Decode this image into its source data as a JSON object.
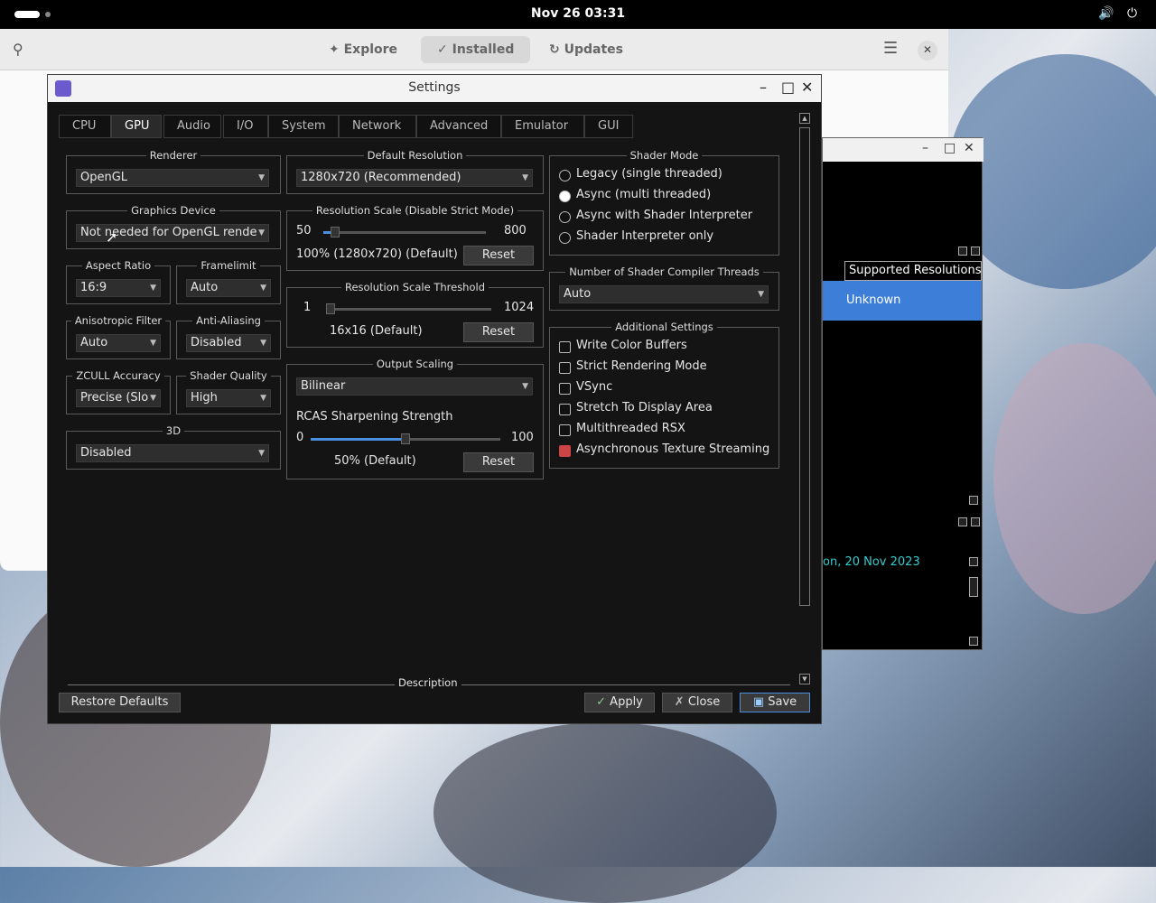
{
  "topbar": {
    "clock": "Nov 26  03:31"
  },
  "store": {
    "tabs": [
      {
        "icon": "✦",
        "label": "Explore"
      },
      {
        "icon": "✓",
        "label": "Installed"
      },
      {
        "icon": "↻",
        "label": "Updates"
      }
    ]
  },
  "gamewin": {
    "column_header": "Supported Resolutions",
    "selected_value": "Unknown",
    "date_text": "on, 20 Nov 2023"
  },
  "settings": {
    "title": "Settings",
    "tabs": [
      "CPU",
      "GPU",
      "Audio",
      "I/O",
      "System",
      "Network",
      "Advanced",
      "Emulator",
      "GUI"
    ],
    "active_tab": "GPU",
    "renderer": {
      "label": "Renderer",
      "value": "OpenGL"
    },
    "graphics_device": {
      "label": "Graphics Device",
      "value": "Not needed for OpenGL rende"
    },
    "aspect_ratio": {
      "label": "Aspect Ratio",
      "value": "16:9"
    },
    "framelimit": {
      "label": "Framelimit",
      "value": "Auto"
    },
    "anisotropic": {
      "label": "Anisotropic Filter",
      "value": "Auto"
    },
    "anti_aliasing": {
      "label": "Anti-Aliasing",
      "value": "Disabled"
    },
    "zcull": {
      "label": "ZCULL Accuracy",
      "value": "Precise (Slo"
    },
    "shader_quality": {
      "label": "Shader Quality",
      "value": "High"
    },
    "three_d": {
      "label": "3D",
      "value": "Disabled"
    },
    "default_resolution": {
      "label": "Default Resolution",
      "value": "1280x720 (Recommended)"
    },
    "resolution_scale": {
      "label": "Resolution Scale (Disable Strict Mode)",
      "min": "50",
      "max": "800",
      "value_text": "100% (1280x720) (Default)",
      "reset": "Reset",
      "fraction": 0.07
    },
    "resolution_threshold": {
      "label": "Resolution Scale Threshold",
      "min": "1",
      "max": "1024",
      "value_text": "16x16 (Default)",
      "reset": "Reset",
      "fraction": 0.02
    },
    "output_scaling": {
      "label": "Output Scaling",
      "value": "Bilinear",
      "rcas_label": "RCAS Sharpening Strength",
      "min": "0",
      "max": "100",
      "value_text": "50% (Default)",
      "reset": "Reset",
      "fraction": 0.5
    },
    "shader_mode": {
      "label": "Shader Mode",
      "options": [
        {
          "label": "Legacy (single threaded)",
          "checked": false
        },
        {
          "label": "Async (multi threaded)",
          "checked": true
        },
        {
          "label": "Async with Shader Interpreter",
          "checked": false
        },
        {
          "label": "Shader Interpreter only",
          "checked": false
        }
      ]
    },
    "shader_threads": {
      "label": "Number of Shader Compiler Threads",
      "value": "Auto"
    },
    "additional": {
      "label": "Additional Settings",
      "options": [
        {
          "label": "Write Color Buffers",
          "checked": false
        },
        {
          "label": "Strict Rendering Mode",
          "checked": false
        },
        {
          "label": "VSync",
          "checked": false
        },
        {
          "label": "Stretch To Display Area",
          "checked": false
        },
        {
          "label": "Multithreaded RSX",
          "checked": false
        },
        {
          "label": "Asynchronous Texture Streaming",
          "checked": true
        }
      ]
    },
    "description_label": "Description",
    "buttons": {
      "restore": "Restore Defaults",
      "apply": "Apply",
      "close": "Close",
      "save": "Save"
    }
  }
}
